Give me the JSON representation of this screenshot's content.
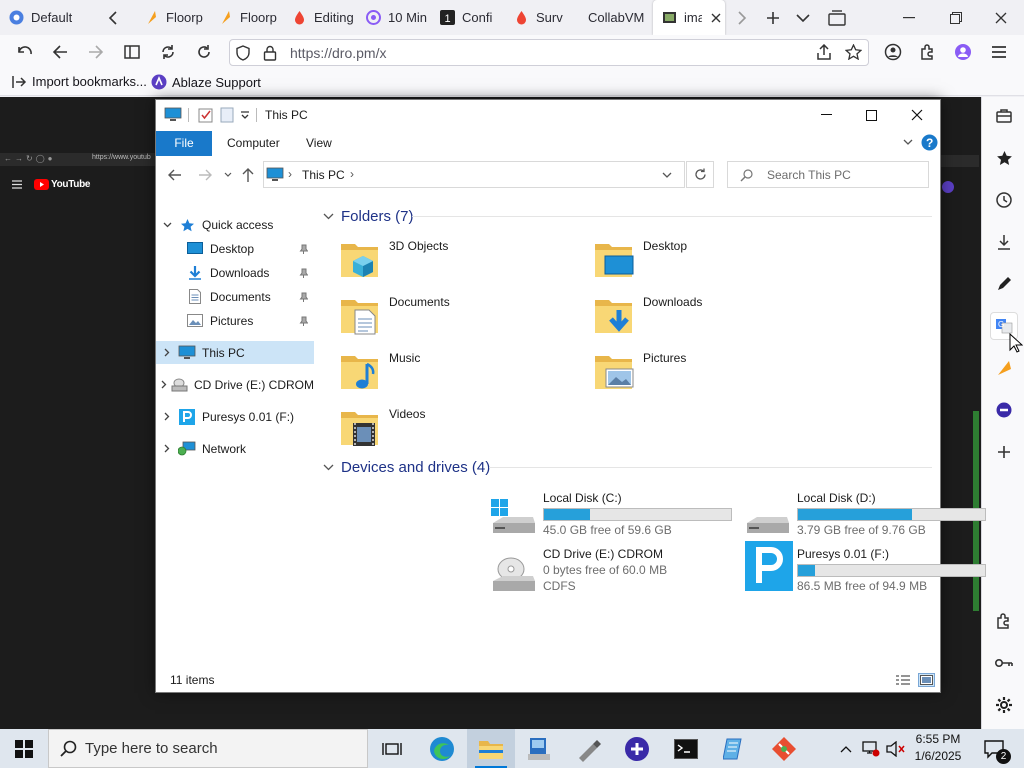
{
  "browser": {
    "tabs": [
      {
        "label": "Default",
        "icon": "floorp-icon",
        "color": "#4a7fe0"
      },
      {
        "label": "Floorp",
        "icon": "floorp-icon",
        "color": "#f59f1e"
      },
      {
        "label": "Floorp",
        "icon": "floorp-icon",
        "color": "#f59f1e"
      },
      {
        "label": "Editing",
        "icon": "vivaldi-icon",
        "color": "#e43"
      },
      {
        "label": "10 Min",
        "icon": "tenminmail-icon",
        "color": "#8a5cf5"
      },
      {
        "label": "Confi",
        "icon": "confi-icon",
        "color": "#222"
      },
      {
        "label": "Surv",
        "icon": "vivaldi-icon",
        "color": "#e43"
      },
      {
        "label": "CollabVM",
        "icon": "",
        "color": ""
      },
      {
        "label": "ima",
        "icon": "image-icon",
        "color": "#333",
        "active": true
      }
    ],
    "url": "https://dro.pm/x",
    "bookmarks": [
      {
        "label": "Import bookmarks..."
      },
      {
        "label": "Ablaze Support"
      }
    ],
    "page_preview": {
      "url_snippet": "https://www.youtub",
      "logo_text": "YouTube"
    }
  },
  "explorer": {
    "title": "This PC",
    "ribbon_tabs": [
      "File",
      "Computer",
      "View"
    ],
    "breadcrumb": "This PC",
    "search_placeholder": "Search This PC",
    "nav": {
      "quick_access": "Quick access",
      "qa_items": [
        "Desktop",
        "Downloads",
        "Documents",
        "Pictures"
      ],
      "this_pc": "This PC",
      "cd_drive": "CD Drive (E:) CDROM",
      "puresys": "Puresys 0.01 (F:)",
      "network": "Network"
    },
    "folders_header": "Folders (7)",
    "folders": [
      {
        "name": "3D Objects",
        "icon": "3d-objects-icon"
      },
      {
        "name": "Desktop",
        "icon": "desktop-folder-icon"
      },
      {
        "name": "Documents",
        "icon": "documents-folder-icon"
      },
      {
        "name": "Downloads",
        "icon": "downloads-folder-icon"
      },
      {
        "name": "Music",
        "icon": "music-folder-icon"
      },
      {
        "name": "Pictures",
        "icon": "pictures-folder-icon"
      },
      {
        "name": "Videos",
        "icon": "videos-folder-icon"
      }
    ],
    "devices_header": "Devices and drives (4)",
    "drives": [
      {
        "name": "Local Disk (C:)",
        "free": "45.0 GB free of 59.6 GB",
        "used_fraction": 0.245,
        "icon": "windows-drive-icon"
      },
      {
        "name": "Local Disk (D:)",
        "free": "3.79 GB free of 9.76 GB",
        "used_fraction": 0.61,
        "icon": "hard-drive-icon"
      },
      {
        "name": "CD Drive (E:) CDROM",
        "free": "0 bytes free of 60.0 MB",
        "fs": "CDFS",
        "icon": "cd-drive-icon"
      },
      {
        "name": "Puresys 0.01 (F:)",
        "free": "86.5 MB free of 94.9 MB",
        "used_fraction": 0.09,
        "icon": "puresys-drive-icon"
      }
    ],
    "status": "11 items"
  },
  "taskbar": {
    "search_placeholder": "Type here to search",
    "time": "6:55 PM",
    "date": "1/6/2025",
    "notification_count": "2"
  }
}
